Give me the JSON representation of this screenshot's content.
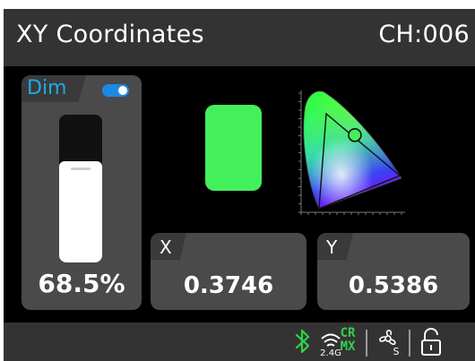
{
  "header": {
    "title": "XY Coordinates",
    "channel": "CH:006"
  },
  "dim": {
    "label": "Dim",
    "toggle_on": true,
    "level_percent": 68.5,
    "value_text": "68.5%"
  },
  "color_swatch": {
    "color": "#44ef5c"
  },
  "cie": {
    "marker_xy": [
      0.3746,
      0.5386
    ]
  },
  "coords": {
    "x_label": "X",
    "x_value": "0.3746",
    "y_label": "Y",
    "y_value": "0.5386"
  },
  "status": {
    "icons": [
      "bluetooth-icon",
      "wireless-2-4g-icon",
      "crmx-icon",
      "fan-icon",
      "lock-icon"
    ],
    "wireless_label": "2.4G",
    "crmx_line1": "CR",
    "crmx_line2": "MX",
    "fan_label": "S",
    "accent_color": "#32d14a"
  },
  "colors": {
    "background": "#000000",
    "panel": "#4a4a4a",
    "header": "#333333",
    "dim_label": "#22a9e8",
    "toggle": "#1e88e5"
  }
}
